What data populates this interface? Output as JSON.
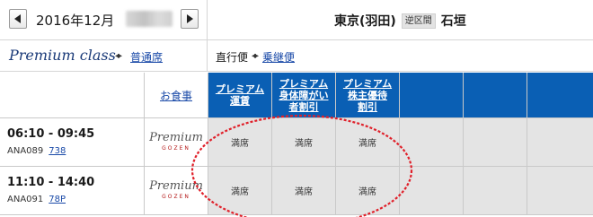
{
  "header": {
    "date": "2016年12月",
    "route": {
      "origin": "東京(羽田)",
      "badge": "逆区間",
      "destination": "石垣"
    }
  },
  "subbar": {
    "premium_class": "Premium class",
    "normal_seat_link": "普通席",
    "direct_label": "直行便",
    "connecting_link": "乗継便"
  },
  "table": {
    "meal_header": "お食事",
    "fare_headers": [
      [
        "プレミアム",
        "運賃"
      ],
      [
        "プレミアム",
        "身体障がい",
        "者割引"
      ],
      [
        "プレミアム",
        "株主優待",
        "割引"
      ]
    ],
    "flights": [
      {
        "time": "06:10 - 09:45",
        "flight_no": "ANA089",
        "aircraft": "738",
        "meal": {
          "main": "Premium",
          "sub": "GOZEN"
        },
        "fares": [
          "満席",
          "満席",
          "満席"
        ]
      },
      {
        "time": "11:10 - 14:40",
        "flight_no": "ANA091",
        "aircraft": "78P",
        "meal": {
          "main": "Premium",
          "sub": "GOZEN"
        },
        "fares": [
          "満席",
          "満席",
          "満席"
        ]
      }
    ]
  },
  "colors": {
    "header_blue": "#0a5fb4",
    "link_blue": "#1a4aa8",
    "annotation_red": "#e0202a",
    "cell_gray": "#e4e4e4"
  },
  "icons": {
    "prev": "chevron-left-icon",
    "next": "chevron-right-icon",
    "swap": "double-arrow-icon"
  }
}
